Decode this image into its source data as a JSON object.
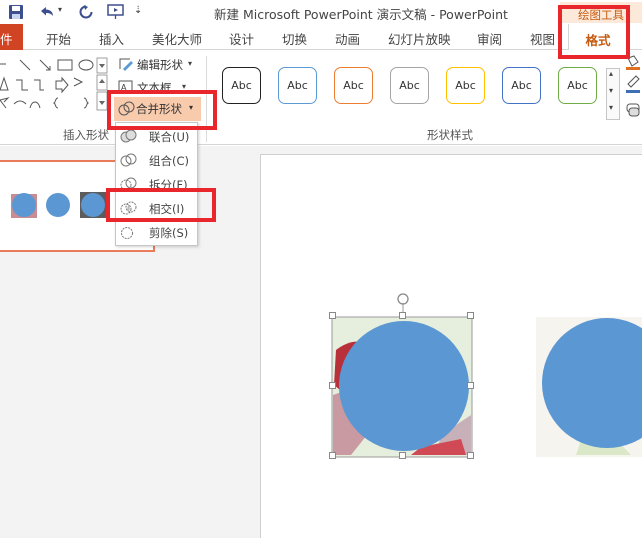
{
  "window": {
    "title": "新建 Microsoft PowerPoint 演示文稿 - PowerPoint",
    "contextual_tab_group": "绘图工具"
  },
  "tabs": [
    {
      "label": "件"
    },
    {
      "label": "开始"
    },
    {
      "label": "插入"
    },
    {
      "label": "美化大师"
    },
    {
      "label": "设计"
    },
    {
      "label": "切换"
    },
    {
      "label": "动画"
    },
    {
      "label": "幻灯片放映"
    },
    {
      "label": "审阅"
    },
    {
      "label": "视图"
    },
    {
      "label": "格式"
    }
  ],
  "ribbon": {
    "edit_shape": "编辑形状",
    "text_box": "文本框",
    "merge_shapes": "合并形状",
    "insert_shapes_group": "插入形状",
    "shape_styles_group": "形状样式",
    "style_sample": "Abc",
    "style_colors": [
      "#222222",
      "#5b9bd5",
      "#ed7d31",
      "#a5a5a5",
      "#ffc000",
      "#4472c4",
      "#70ad47"
    ]
  },
  "merge_menu": {
    "items": [
      {
        "label": "联合(U)"
      },
      {
        "label": "组合(C)"
      },
      {
        "label": "拆分(F)"
      },
      {
        "label": "相交(I)"
      },
      {
        "label": "剪除(S)"
      }
    ]
  },
  "colors": {
    "accent": "#d04423",
    "highlight": "#e8262b",
    "shape_fill": "#5b97d2",
    "format_tab_text": "#c55a11"
  }
}
